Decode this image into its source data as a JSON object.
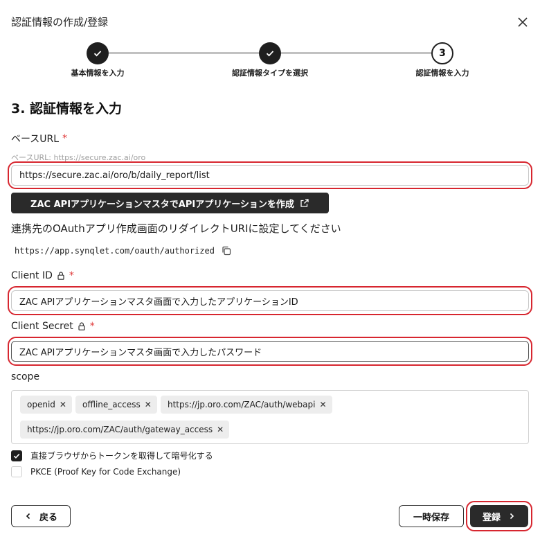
{
  "dialog": {
    "title": "認証情報の作成/登録"
  },
  "stepper": {
    "steps": [
      {
        "label": "基本情報を入力",
        "state": "done"
      },
      {
        "label": "認証情報タイプを選択",
        "state": "done"
      },
      {
        "label": "認証情報を入力",
        "state": "current",
        "number": "3"
      }
    ]
  },
  "section": {
    "title": "3. 認証情報を入力"
  },
  "base_url": {
    "label": "ベースURL",
    "required_mark": "*",
    "helper": "ベースURL: https://secure.zac.ai/oro",
    "value": "https://secure.zac.ai/oro/b/daily_report/list"
  },
  "create_app_button": {
    "label": "ZAC APIアプリケーションマスタでAPIアプリケーションを作成"
  },
  "redirect": {
    "instruction": "連携先のOAuthアプリ作成画面のリダイレクトURIに設定してください",
    "uri": "https://app.synqlet.com/oauth/authorized"
  },
  "client_id": {
    "label": "Client ID",
    "required_mark": "*",
    "value": "ZAC APIアプリケーションマスタ画面で入力したアプリケーションID"
  },
  "client_secret": {
    "label": "Client Secret",
    "required_mark": "*",
    "value": "ZAC APIアプリケーションマスタ画面で入力したパスワード"
  },
  "scope": {
    "label": "scope",
    "chips": [
      "openid",
      "offline_access",
      "https://jp.oro.com/ZAC/auth/webapi",
      "https://jp.oro.com/ZAC/auth/gateway_access"
    ],
    "remove_glyph": "✕"
  },
  "options": [
    {
      "label": "直接ブラウザからトークンを取得して暗号化する",
      "checked": true
    },
    {
      "label": "PKCE (Proof Key for Code Exchange)",
      "checked": false
    }
  ],
  "footer": {
    "back_label": "戻る",
    "save_label": "一時保存",
    "register_label": "登録"
  },
  "colors": {
    "highlight": "#d7262f",
    "dark": "#2a2a2a",
    "required": "#e03a3a"
  }
}
